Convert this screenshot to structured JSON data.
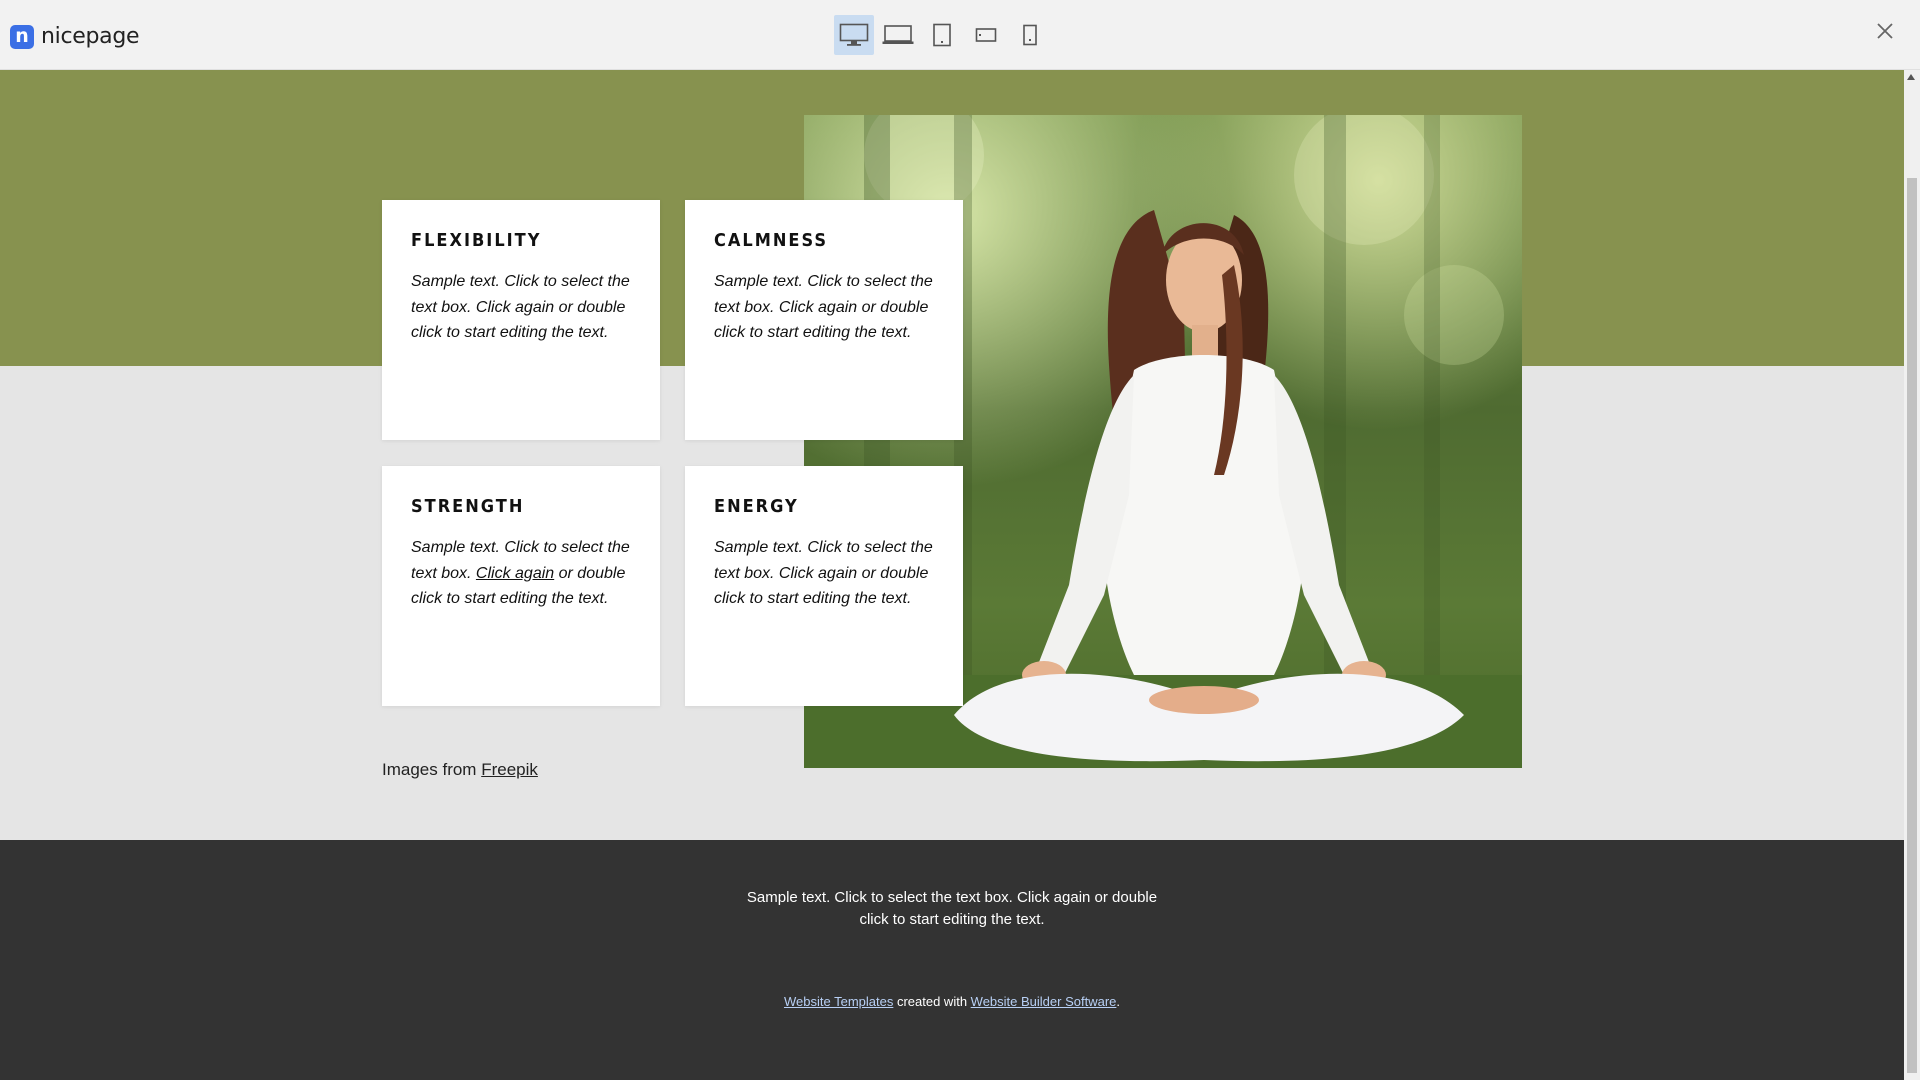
{
  "app": {
    "logo_letter": "n",
    "name": "nicepage",
    "devices": [
      {
        "name": "desktop",
        "active": true
      },
      {
        "name": "laptop",
        "active": false
      },
      {
        "name": "tablet",
        "active": false
      },
      {
        "name": "phone-landscape",
        "active": false
      },
      {
        "name": "phone-portrait",
        "active": false
      }
    ]
  },
  "cards": [
    {
      "title": "FLEXIBILITY",
      "text": "Sample text. Click to select the text box. Click again or double click to start editing the text."
    },
    {
      "title": "CALMNESS",
      "text": "Sample text. Click to select the text box. Click again or double click to start editing the text."
    },
    {
      "title": "STRENGTH",
      "text_before": "Sample text. Click to select the text box. ",
      "text_link": "Click again",
      "text_after": " or double click to start editing the text."
    },
    {
      "title": "ENERGY",
      "text": "Sample text. Click to select the text box. Click again or double click to start editing the text."
    }
  ],
  "credit": {
    "prefix": "Images from ",
    "link": "Freepik"
  },
  "footer": {
    "text": "Sample text. Click to select the text box. Click again or double click to start editing the text.",
    "link1": "Website Templates",
    "middle": " created with ",
    "link2": "Website Builder Software",
    "suffix": "."
  },
  "colors": {
    "band": "#87924f",
    "footer": "#333333",
    "brand": "#3b6fe5",
    "active_device": "#c9dcf1"
  }
}
